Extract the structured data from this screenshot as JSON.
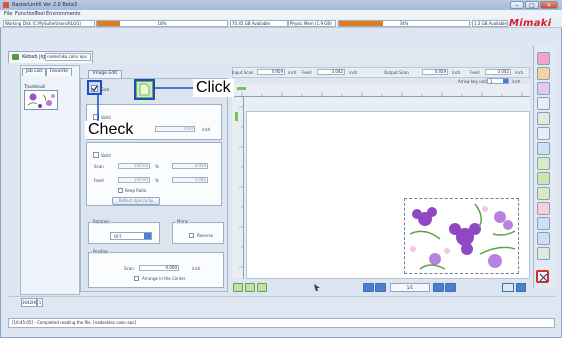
{
  "window": {
    "title": "RasterLink6 Ver 2.0 Beta3",
    "minimize": "–",
    "maximize": "□",
    "close": "×"
  },
  "menu": [
    "File",
    "Function",
    "Tool",
    "Environments"
  ],
  "status": {
    "working_disk": "Working Disk (C:MySuite/Users/RL6/1)",
    "working_progress_pct": 18,
    "working_progress_label": "18%",
    "disk_available": "70.45 GB Available",
    "phys_mem": "Physic Mem (1.9 GB)",
    "mem_progress_pct": 34,
    "mem_progress_label": "34%",
    "mem_available": "1.3 GB Available",
    "logo": "Mimaki"
  },
  "job_tab": {
    "label": "Kebab Jig Print",
    "file": "nadeshiko color eps"
  },
  "left_panel": {
    "tabs": [
      "Job List",
      "Favorite"
    ],
    "thumbnail_label": "Thumbnail"
  },
  "edit": {
    "tab_label": "Image Edit",
    "size_group": "Size",
    "valid_label": "Valid",
    "size_value": "0.00",
    "size_unit": "inch",
    "scale_valid_label": "Valid",
    "scan_label": "Scan",
    "scan_pct": "100.00",
    "scan_value": "4.959",
    "feed_label": "Feed",
    "feed_pct": "100.00",
    "feed_value": "3.042",
    "pct_sign": "%",
    "keep_ratio": "Keep Ratio",
    "reflect_label": "Reflect dpi/cm/lpi",
    "rotation_group": "Rotation",
    "rotation_value": "OFF",
    "mirror_group": "Mirror",
    "reverse_label": "Reverse",
    "position_group": "Position",
    "pos_scan_label": "Scan",
    "pos_scan_value": "0.000",
    "pos_unit": "inch",
    "arrange_center": "Arrange in the Center"
  },
  "top_bar": {
    "input_scan_label": "Input Scan",
    "input_scan_value": "4.959",
    "input_scan_unit": "inch",
    "input_feed_label": "Feed",
    "input_feed_value": "3.042",
    "input_feed_unit": "inch",
    "output_scan_label": "Output Scan",
    "output_scan_value": "4.959",
    "output_scan_unit": "inch",
    "output_feed_label": "Feed",
    "output_feed_value": "3.042",
    "output_feed_unit": "inch",
    "arrow_key_label": "Arrow key unit",
    "arrow_key_value": "1",
    "arrow_key_unit": "inch"
  },
  "page_counter": "1/1",
  "bottom_tab": "3042HC",
  "bottom_tab_extra": "1",
  "log_text": "[16:45:05] - Completed reading the file. [nadeshiko color eps]",
  "callouts": {
    "click": "Click",
    "check": "Check"
  },
  "colors": {
    "highlight": "#1b4ec4",
    "accent_red": "#d0302c",
    "progress": "#e07b1e",
    "logo": "#d2202c"
  }
}
